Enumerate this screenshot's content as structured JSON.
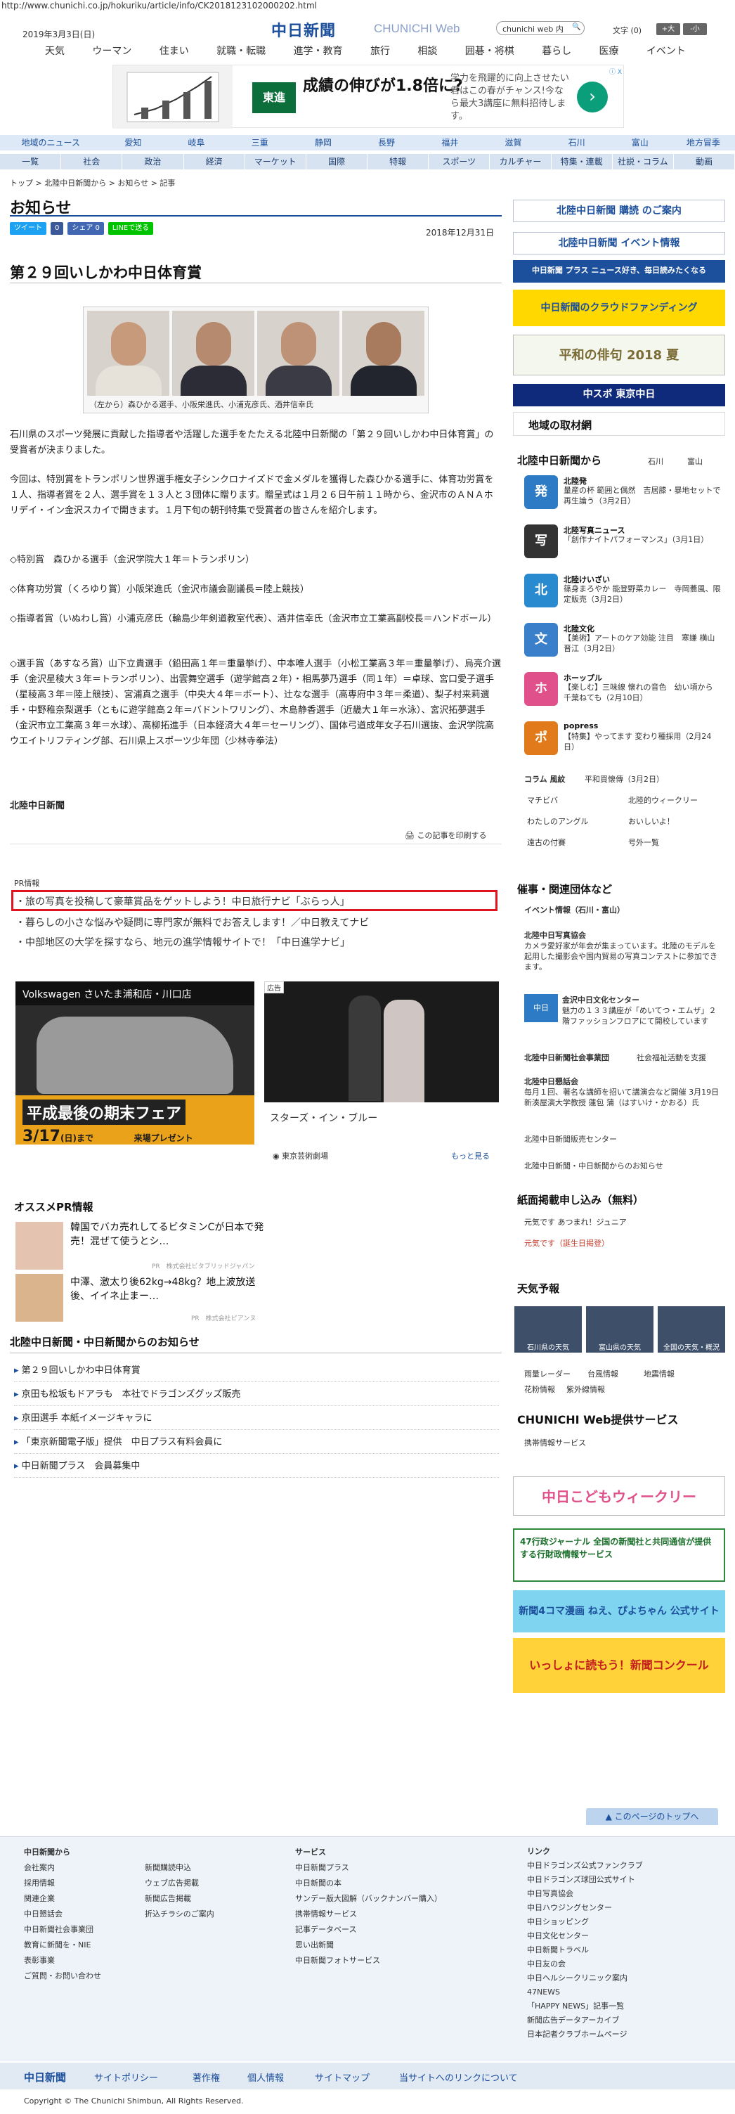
{
  "url": "http://www.chunichi.co.jp/hokuriku/article/info/CK2018123102000202.html",
  "header": {
    "date": "2019年3月3日(日)",
    "logo": "中日新聞",
    "logo_en": "CHUNICHI Web",
    "search_placeholder": "chunichi web 内",
    "search_btn": "検索",
    "font_label": "文字 (0)",
    "font_plus": "+大",
    "font_minus": "-小"
  },
  "gnav": [
    "天気",
    "ウーマン",
    "住まい",
    "就職・転職",
    "進学・教育",
    "旅行",
    "相談",
    "囲碁・将棋",
    "暮らし",
    "医療",
    "イベント"
  ],
  "top_ad": {
    "brand": "東進",
    "headline": "成績の伸びが1.8倍に?",
    "sub": "学力を飛躍的に向上させたい君はこの春がチャンス!今なら最大3講座に無料招待します。",
    "close": "ⓘ X"
  },
  "region_nav": [
    "地域のニュース",
    "愛知",
    "岐阜",
    "三重",
    "静岡",
    "長野",
    "福井",
    "滋賀",
    "石川",
    "富山",
    "地方冒季"
  ],
  "category_nav": [
    "一覧",
    "社会",
    "政治",
    "経済",
    "マーケット",
    "国際",
    "特報",
    "スポーツ",
    "カルチャー",
    "特集・連載",
    "社説・コラム",
    "動画"
  ],
  "breadcrumb": "トップ > 北陸中日新聞から > お知らせ > 記事",
  "page_title": "お知らせ",
  "share": {
    "tweet": "ツイート",
    "fb": "0",
    "hatena": "シェア 0",
    "line": "LINEで送る"
  },
  "article": {
    "date": "2018年12月31日",
    "title": "第２９回いしかわ中日体育賞",
    "caption": "（左から）森ひかる選手、小阪栄進氏、小浦克彦氏、酒井信幸氏",
    "paragraphs": [
      "石川県のスポーツ発展に貢献した指導者や活躍した選手をたたえる北陸中日新聞の「第２９回いしかわ中日体育賞」の受賞者が決まりました。",
      "今回は、特別賞をトランポリン世界選手権女子シンクロナイズドで金メダルを獲得した森ひかる選手に、体育功労賞を１人、指導者賞を２人、選手賞を１３人と３団体に贈ります。贈呈式は１月２６日午前１１時から、金沢市のＡＮＡホリデイ・イン金沢スカイで開きます。１月下旬の朝刊特集で受賞者の皆さんを紹介します。",
      "◇特別賞　森ひかる選手（金沢学院大１年＝トランポリン）",
      "◇体育功労賞（くろゆり賞）小阪栄進氏（金沢市議会副議長＝陸上競技）",
      "◇指導者賞（いぬわし賞）小浦克彦氏（輪島少年剣道教室代表）、酒井信幸氏（金沢市立工業高副校長＝ハンドボール）",
      "◇選手賞（あすなろ賞）山下立貴選手（鉛田高１年＝重量挙げ）、中本唯人選手（小松工業高３年＝重量挙げ）、烏亮介選手（金沢星稜大３年＝トランポリン）、出雲舞空選手（遊学館高２年）・相馬夢乃選手（同１年）＝卓球、宮口愛子選手（星稜高３年＝陸上競技）、宮浦真之選手（中央大４年＝ボート）、辻なな選手（高専府中３年＝柔道）、梨子村来莉選手・中野稚奈梨選手（ともに遊学館高２年＝バドントワリング）、木島静香選手（近畿大１年＝水泳）、宮沢拓夢選手（金沢市立工業高３年＝水球）、高柳拓進手（日本経済大４年＝セーリング）、国体弓道成年女子石川選抜、金沢学院高ウエイトリフティング部、石川県上スポーツ少年団（少林寺拳法）"
    ],
    "signature": "北陸中日新聞",
    "print": "この記事を印刷する"
  },
  "pr": {
    "label": "PR情報",
    "items": [
      "旅の写真を投稿して豪華賞品をゲットしよう！中日旅行ナビ「ぶらっ人」",
      "暮らしの小さな悩みや疑問に専門家が無料でお答えします！／中日教えてナビ",
      "中部地区の大学を探すなら、地元の進学情報サイトで！「中日進学ナビ」"
    ]
  },
  "ads": {
    "vw_brand": "Volkswagen さいたま浦和店・川口店",
    "vw_fair": "平成最後の期末フェア",
    "vw_date": "3/17",
    "vw_date_sub": "(日)まで",
    "vw_visit": "来場プレゼント",
    "star_label": "広告",
    "star_caption": "スターズ・イン・ブルー",
    "star_theater": "東京芸術劇場",
    "star_more": "もっと見る"
  },
  "ossume": {
    "heading": "オススメPR情報",
    "items": [
      {
        "title": "韓国でバカ売れしてるビタミンCが日本で発売！混ぜて使うとシ…",
        "sponsor": "PR　株式会社ビタブリッドジャパン"
      },
      {
        "title": "中澤、激太り後62kg→48kg？地上波放送後、イイネ止まー…",
        "sponsor": "PR　株式会社ピアンヌ"
      }
    ]
  },
  "news_section": {
    "heading": "北陸中日新聞・中日新聞からのお知らせ",
    "items": [
      "第２９回いしかわ中日体育賞",
      "京田も松坂もドアラも　本社でドラゴンズグッズ販売",
      "京田選手 本紙イメージキャラに",
      "「東京新聞電子版」提供　中日プラス有料会員に",
      "中日新聞プラス　会員募集中"
    ]
  },
  "sidebar": {
    "banners": [
      "北陸中日新聞 購読 のご案内",
      "北陸中日新聞 イベント情報",
      "中日新聞 プラス ニュース好き、毎日読みたくなる",
      "中日新聞のクラウドファンディング",
      "平和の俳句 2018 夏",
      "中スポ 東京中日"
    ],
    "local_heading": "地域の取材網",
    "from_heading": "北陸中日新聞から",
    "from_tabs": [
      "石川",
      "富山"
    ],
    "from_items": [
      {
        "icon": "発",
        "color": "#2c7bc4",
        "title": "北陸発",
        "desc": "量産の杯 範囲と偶然　吉居膝・暴地セットで再生論う（3月2日）"
      },
      {
        "icon": "写",
        "color": "#333333",
        "title": "北陸写真ニュース",
        "desc": "「創作ナイトパフォーマンス」（3月1日）"
      },
      {
        "icon": "北",
        "color": "#2a8ad0",
        "title": "北陸けいざい",
        "desc": "篠身まろやか 能登野菜カレー　寺岡蕎風、限定販売（3月2日）"
      },
      {
        "icon": "文",
        "color": "#3a7fc9",
        "title": "北陸文化",
        "desc": "【美術】アートのケア効能 注目　寒嫌 横山晋江（3月2日）"
      },
      {
        "icon": "ホ",
        "color": "#e0508a",
        "title": "ホーップル",
        "desc": "【楽しむ】三味線 懐れの音色　幼い頃から 千葉ねても（2月10日）"
      },
      {
        "icon": "ポ",
        "color": "#e07a1a",
        "title": "popress",
        "desc": "【特集】やってます 変わり種採用（2月24日）"
      }
    ],
    "column_links": [
      "コラム 風紋",
      "平和買懐傳（3月2日）",
      "マチビバ",
      "北陸的ウィークリー",
      "わたしのアングル",
      "おいしいよ！",
      "遠古の付賽",
      "号外一覧"
    ],
    "events_heading": "催事・関連団体など",
    "events_sub": "イベント情報（石川・富山）",
    "events": [
      {
        "title": "北陸中日写真協会",
        "desc": "カメラ愛好家が年会が集まっています。北陸のモデルを起用した撮影会や国内貿易の写真コンテストに参加できます。"
      },
      {
        "title": "金沢中日文化センター",
        "desc": "魅力の１３３講座が「めいてつ・エムザ」２階ファッションフロアにて開校しています"
      },
      {
        "title": "北陸中日新聞社会事業団",
        "desc": "社会福祉活動を支援"
      },
      {
        "title": "北陸中日懇話会",
        "desc": "毎月１回、著名な講師を招いて講演会など開催 3月19日 新湊屋演大学教授 蓮包 蒲（はすいけ・かおる）氏"
      }
    ],
    "event_links": [
      "北陸中日新聞販売センター",
      "北陸中日新聞・中日新聞からのお知らせ"
    ],
    "apply_heading": "紙面掲載申し込み（無料）",
    "apply_links": [
      "元気です あつまれ！ジュニア",
      "元気です（誕生日掲登）"
    ],
    "weather_heading": "天気予報",
    "weather": [
      "石川県の天気",
      "富山県の天気",
      "全国の天気・概況"
    ],
    "weather_links": [
      "雨量レーダー",
      "台風情報",
      "地震情報",
      "花粉情報",
      "紫外線情報"
    ],
    "web_service_heading": "CHUNICHI Web提供サービス",
    "web_service_link": "携帯情報サービス",
    "bottom_banners": [
      "中日こどもウィークリー",
      "47行政ジャーナル 全国の新聞社と共同通信が提供する行財政情報サービス",
      "新聞4コマ漫画 ねえ、ぴよちゃん 公式サイト",
      "いっしょに読もう！新聞コンクール"
    ]
  },
  "footer": {
    "pagetop": "このページのトップへ",
    "col1": [
      "中日新聞から",
      "会社案内",
      "採用情報",
      "関連企業",
      "中日懇話会",
      "中日新聞社会事業団",
      "教育に新聞を・NIE",
      "表彰事業",
      "ご質問・お問い合わせ"
    ],
    "col2": [
      "新聞購読申込",
      "ウェブ広告掲載",
      "新聞広告掲載",
      "折込チラシのご案内"
    ],
    "col3": [
      "サービス",
      "中日新聞プラス",
      "中日新聞の本",
      "サンデー版大図解（バックナンバー購入）",
      "携帯情報サービス",
      "記事データベース",
      "思い出新聞",
      "中日新聞フォトサービス"
    ],
    "col4": [
      "リンク",
      "中日ドラゴンズ公式ファンクラブ",
      "中日ドラゴンズ球団公式サイト",
      "中日写真協会",
      "中日ハウジングセンター",
      "中日ショッピング",
      "中日文化センター",
      "中日新聞トラベル",
      "中日友の会",
      "中日ヘルシークリニック案内",
      "47NEWS",
      "「HAPPY NEWS」記事一覧",
      "新聞広告データアーカイブ",
      "日本記者クラブホームページ"
    ],
    "bar": [
      "中日新聞",
      "サイトポリシー",
      "著作権",
      "個人情報",
      "サイトマップ",
      "当サイトへのリンクについて"
    ],
    "copyright": "Copyright © The Chunichi Shimbun, All Rights Reserved."
  }
}
